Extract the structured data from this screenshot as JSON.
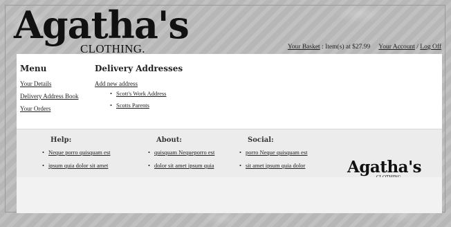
{
  "header": {
    "logo_word": "Agatha's",
    "logo_sub": "CLOTHING.",
    "basket_link": "Your Basket",
    "basket_text": " : Item(s) at $27.99",
    "account_link": "Your Account",
    "separator": " / ",
    "logout_link": "Log Off"
  },
  "menu": {
    "title": "Menu",
    "items": [
      "Your Details",
      "Delivery Address Book",
      "Your Orders"
    ]
  },
  "addresses": {
    "title": "Delivery Addresses",
    "add_link": "Add new address",
    "items": [
      "Scott's Work Address",
      "Scotts Parents"
    ]
  },
  "footer": {
    "help": {
      "title": "Help:",
      "links": [
        "Neque porro quisquam est",
        "ipsum quia dolor sit amet"
      ]
    },
    "about": {
      "title": "About:",
      "links": [
        "quisquam Nequeporro est",
        "dolor sit amet ipsum quia"
      ]
    },
    "social": {
      "title": "Social:",
      "links": [
        "porro Neque quisquam est",
        "sit amet ipsum quia dolor"
      ]
    },
    "logo_word": "Agatha's",
    "logo_sub": "CLOTHING."
  }
}
